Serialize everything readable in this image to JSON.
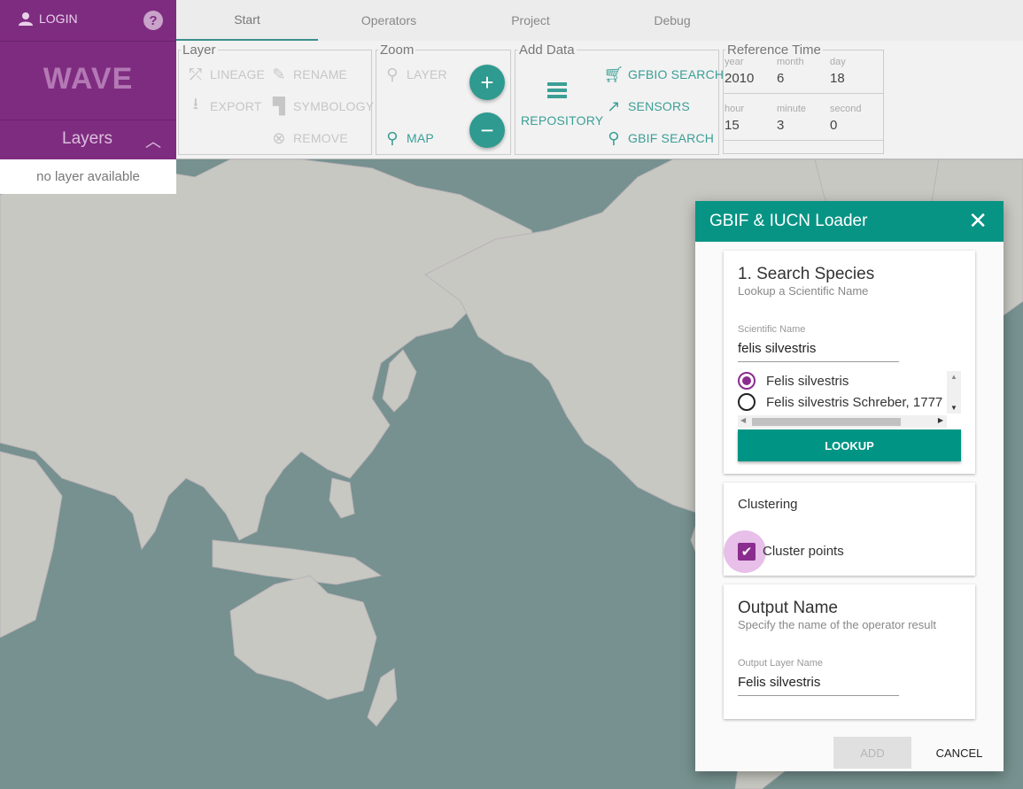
{
  "sidebar": {
    "login_label": "LOGIN",
    "help_label": "?",
    "brand": "WAVE",
    "layers_title": "Layers",
    "no_layer_text": "no layer available"
  },
  "tabs": [
    {
      "label": "Start"
    },
    {
      "label": "Operators"
    },
    {
      "label": "Project"
    },
    {
      "label": "Debug"
    }
  ],
  "toolbar": {
    "layer": {
      "legend": "Layer",
      "lineage": "LINEAGE",
      "rename": "RENAME",
      "export": "EXPORT",
      "symbology": "SYMBOLOGY",
      "remove": "REMOVE"
    },
    "zoom": {
      "legend": "Zoom",
      "layer": "LAYER",
      "map": "MAP",
      "zoom_in": "+",
      "zoom_out": "−"
    },
    "add_data": {
      "legend": "Add Data",
      "repository": "REPOSITORY",
      "gfbio_search": "GFBIO SEARCH",
      "sensors": "SENSORS",
      "gbif_search": "GBIF SEARCH"
    },
    "reference_time": {
      "legend": "Reference Time",
      "year_label": "year",
      "year": "2010",
      "month_label": "month",
      "month": "6",
      "day_label": "day",
      "day": "18",
      "hour_label": "hour",
      "hour": "15",
      "minute_label": "minute",
      "minute": "3",
      "second_label": "second",
      "second": "0"
    }
  },
  "dialog": {
    "title": "GBIF & IUCN Loader",
    "close": "✕",
    "search": {
      "title": "1. Search Species",
      "subtitle": "Lookup a Scientific Name",
      "field_label": "Scientific Name",
      "field_value": "felis silvestris",
      "options": [
        {
          "label": "Felis silvestris",
          "selected": true
        },
        {
          "label": "Felis silvestris Schreber, 1777",
          "selected": false
        }
      ],
      "lookup_button": "LOOKUP"
    },
    "clustering": {
      "title": "Clustering",
      "checkbox_label": "Cluster points",
      "checked": true
    },
    "output": {
      "title": "Output Name",
      "subtitle": "Specify the name of the operator result",
      "field_label": "Output Layer Name",
      "field_value": "Felis silvestris"
    },
    "add_button": "ADD",
    "cancel_button": "CANCEL"
  },
  "colors": {
    "sidebar": "#7e2c80",
    "accent": "#089484",
    "map_water": "#76918f",
    "map_land": "#c9c9c4"
  }
}
